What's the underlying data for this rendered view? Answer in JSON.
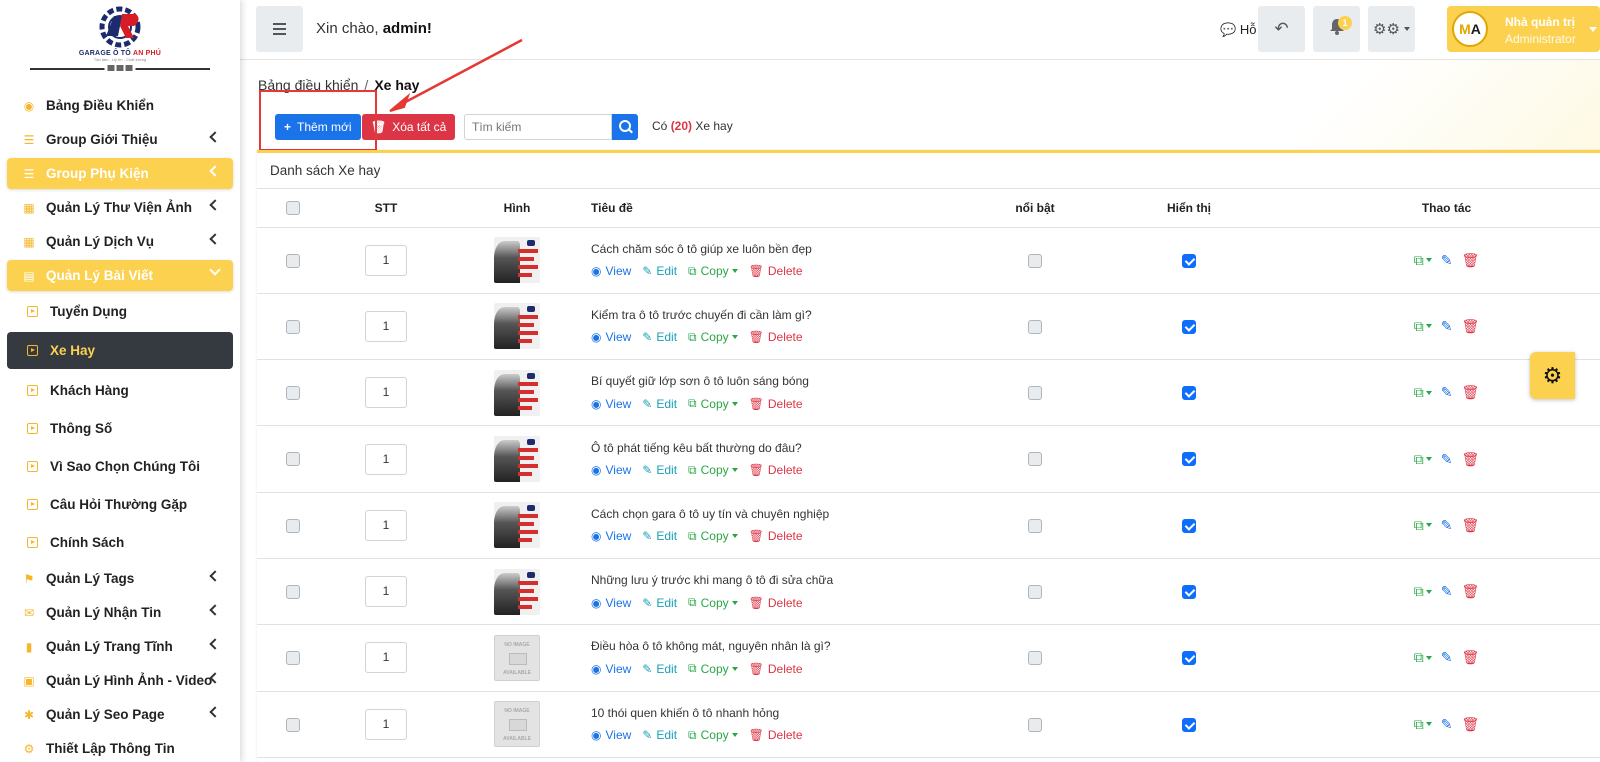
{
  "brand": {
    "logo_line1_a": "GARAGE Ô TÔ ",
    "logo_line1_b": "AN PHÚ",
    "logo_line2": "Tận tâm - Uy tín - Chất lượng"
  },
  "sidebar": {
    "items": [
      {
        "label": "Bảng Điều Khiển",
        "icon": "dashboard-icon",
        "chevron": false
      },
      {
        "label": "Group Giới Thiệu",
        "icon": "layers-icon",
        "chevron": true
      },
      {
        "label": "Group Phụ Kiện",
        "icon": "layers-icon",
        "chevron": true,
        "highlighted": true
      },
      {
        "label": "Quản Lý Thư Viện Ảnh",
        "icon": "boxes-icon",
        "chevron": true
      },
      {
        "label": "Quản Lý Dịch Vụ",
        "icon": "boxes-icon",
        "chevron": true
      },
      {
        "label": "Quản Lý Bài Viết",
        "icon": "book-icon",
        "chevron": true,
        "highlighted": true,
        "expanded": true
      }
    ],
    "subitems": [
      {
        "label": "Tuyển Dụng"
      },
      {
        "label": "Xe Hay",
        "active": true
      },
      {
        "label": "Khách Hàng"
      },
      {
        "label": "Thông Số"
      },
      {
        "label": "Vì Sao Chọn Chúng Tôi"
      },
      {
        "label": "Câu Hỏi Thường Gặp"
      },
      {
        "label": "Chính Sách"
      }
    ],
    "items_after": [
      {
        "label": "Quản Lý Tags",
        "icon": "tag-icon",
        "chevron": true
      },
      {
        "label": "Quản Lý Nhận Tin",
        "icon": "envelope-icon",
        "chevron": true
      },
      {
        "label": "Quản Lý Trang Tĩnh",
        "icon": "bookmark-icon",
        "chevron": true
      },
      {
        "label": "Quản Lý Hình Ảnh - Video",
        "icon": "photo-icon",
        "chevron": true
      },
      {
        "label": "Quản Lý Seo Page",
        "icon": "share-icon",
        "chevron": true
      },
      {
        "label": "Thiết Lập Thông Tin",
        "icon": "cogs-icon",
        "chevron": false
      }
    ]
  },
  "topbar": {
    "greeting": "Xin chào, ",
    "greeting_name": "admin!",
    "support_label": "Hỗ trợ",
    "notification_count": "1",
    "user_name": "Nhà quản trị",
    "user_role": "Administrator",
    "avatar_text_a": "M",
    "avatar_text_b": "A"
  },
  "breadcrumb": {
    "root": "Bảng điều khiển",
    "separator": "/",
    "current": "Xe hay"
  },
  "toolbar": {
    "add_label": "Thêm mới",
    "delete_all_label": "Xóa tất cả",
    "search_placeholder": "Tìm kiếm",
    "count_prefix": "Có ",
    "count_value": "(20)",
    "count_suffix": " Xe hay"
  },
  "card": {
    "title": "Danh sách Xe hay"
  },
  "table": {
    "headers": {
      "stt": "STT",
      "image": "Hình",
      "title": "Tiêu đề",
      "featured": "nổi bật",
      "visible": "Hiển thị",
      "actions": "Thao tác"
    },
    "action_labels": {
      "view": "View",
      "edit": "Edit",
      "copy": "Copy",
      "delete": "Delete"
    },
    "noimg_text_1": "NO IMAGE",
    "noimg_text_2": "AVAILABLE",
    "rows": [
      {
        "stt": "1",
        "title": "Cách chăm sóc ô tô giúp xe luôn bền đẹp",
        "image": "photo",
        "featured": false,
        "visible": true
      },
      {
        "stt": "1",
        "title": "Kiểm tra ô tô trước chuyến đi cần làm gì?",
        "image": "photo",
        "featured": false,
        "visible": true
      },
      {
        "stt": "1",
        "title": "Bí quyết giữ lớp sơn ô tô luôn sáng bóng",
        "image": "photo",
        "featured": false,
        "visible": true
      },
      {
        "stt": "1",
        "title": "Ô tô phát tiếng kêu bất thường do đâu?",
        "image": "photo",
        "featured": false,
        "visible": true
      },
      {
        "stt": "1",
        "title": "Cách chọn gara ô tô uy tín và chuyên nghiệp",
        "image": "photo",
        "featured": false,
        "visible": true
      },
      {
        "stt": "1",
        "title": "Những lưu ý trước khi mang ô tô đi sửa chữa",
        "image": "photo",
        "featured": false,
        "visible": true
      },
      {
        "stt": "1",
        "title": "Điều hòa ô tô không mát, nguyên nhân là gì?",
        "image": "no-image",
        "featured": false,
        "visible": true
      },
      {
        "stt": "1",
        "title": "10 thói quen khiến ô tô nhanh hỏng",
        "image": "no-image",
        "featured": false,
        "visible": true
      }
    ]
  },
  "colors": {
    "accent": "#fcd14f",
    "sidebar_active": "#343a40",
    "primary": "#1a73e8",
    "danger": "#dc3545",
    "success": "#28a745"
  }
}
